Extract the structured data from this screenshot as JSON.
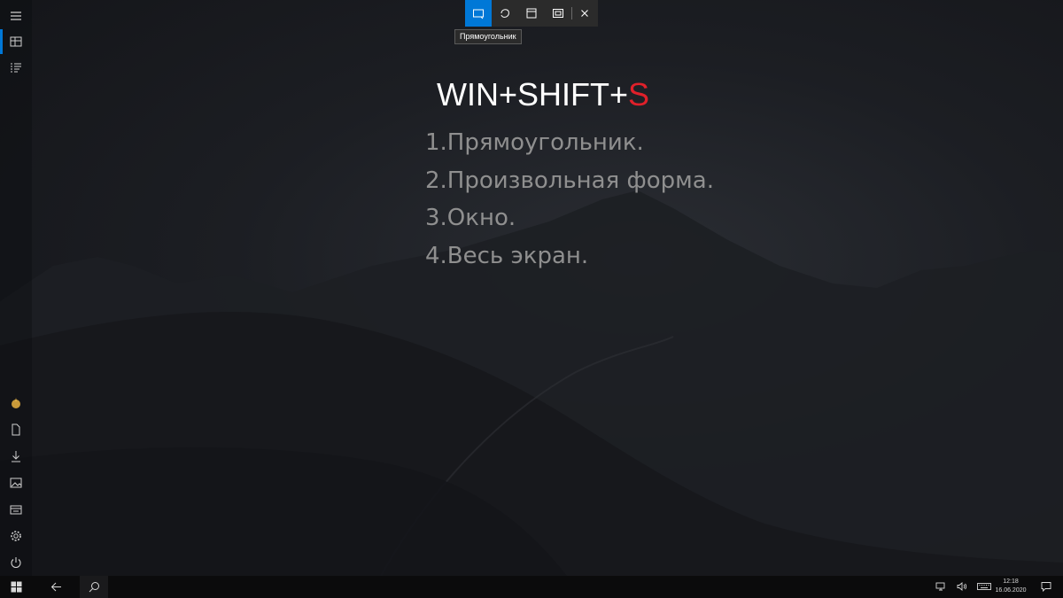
{
  "snip_toolbar": {
    "modes": [
      {
        "name": "rectangular-snip",
        "icon": "rectangle-snip-icon",
        "active": true
      },
      {
        "name": "freeform-snip",
        "icon": "freeform-snip-icon",
        "active": false
      },
      {
        "name": "window-snip",
        "icon": "window-snip-icon",
        "active": false
      },
      {
        "name": "fullscreen-snip",
        "icon": "fullscreen-snip-icon",
        "active": false
      }
    ],
    "close_icon": "close-icon",
    "tooltip": "Прямоугольник"
  },
  "overlay": {
    "title_prefix": "WIN+SHIFT+",
    "title_accent": "S",
    "items": [
      "1.Прямоугольник.",
      "2.Произвольная форма.",
      "3.Окно.",
      "4.Весь экран."
    ]
  },
  "left_rail": {
    "top_icons": [
      "hamburger-menu-icon",
      "tiles-icon",
      "list-icon"
    ],
    "bottom_icons": [
      "user-avatar-icon",
      "documents-icon",
      "downloads-icon",
      "pictures-icon",
      "explorer-icon",
      "settings-icon",
      "power-icon"
    ]
  },
  "taskbar": {
    "icons": [
      "start-icon",
      "back-icon",
      "search-icon"
    ],
    "tray_icons": [
      "network-icon",
      "volume-icon",
      "keyboard-icon",
      "notifications-icon"
    ],
    "clock_time": "12:18",
    "clock_date": "16.06.2020"
  },
  "colors": {
    "accent": "#0078d7",
    "title_accent": "#e0202a",
    "list_text": "#8f8f8f",
    "toolbar_bg": "#2b2b2b",
    "taskbar_bg": "#0b0b0c"
  }
}
